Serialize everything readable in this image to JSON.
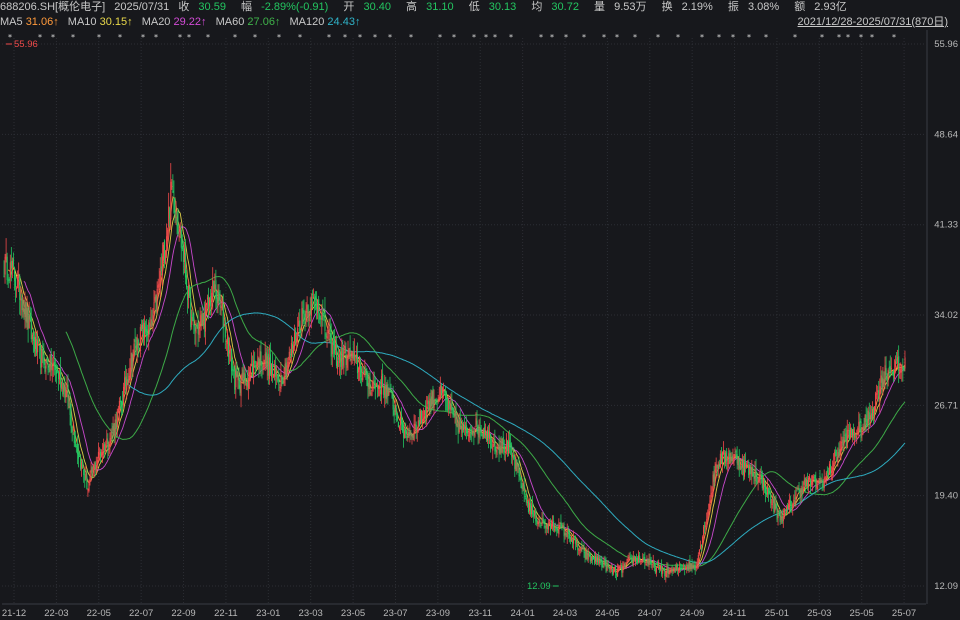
{
  "header": {
    "symbol": "688206.SH[概伦电子]",
    "date": "2025/07/31",
    "close_label": "收",
    "close": "30.59",
    "change_label": "幅",
    "change": "-2.89%(-0.91)",
    "open_label": "开",
    "open": "30.40",
    "high_label": "高",
    "high": "31.10",
    "low_label": "低",
    "low": "30.13",
    "avg_label": "均",
    "avg": "30.72",
    "volume_label": "量",
    "volume": "9.53万",
    "turnover_label": "换",
    "turnover": "2.19%",
    "amplitude_label": "振",
    "amplitude": "3.08%",
    "amount_label": "额",
    "amount": "2.93亿"
  },
  "range": "2021/12/28-2025/07/31(870日)",
  "ma": [
    {
      "name": "MA5",
      "value": "31.06↑",
      "color": "#ff9a3c"
    },
    {
      "name": "MA10",
      "value": "30.15↑",
      "color": "#e8d84a"
    },
    {
      "name": "MA20",
      "value": "29.22↑",
      "color": "#d24bd6"
    },
    {
      "name": "MA60",
      "value": "27.06↑",
      "color": "#3fb24a"
    },
    {
      "name": "MA120",
      "value": "24.43↑",
      "color": "#2fb3c8"
    }
  ],
  "colors": {
    "up": "#f04a4a",
    "down": "#23c560",
    "background": "#17181c",
    "grid": "#2c2e34"
  },
  "chart_data": {
    "type": "candlestick",
    "y_ticks": [
      "55.96",
      "48.64",
      "41.33",
      "34.02",
      "26.71",
      "19.40",
      "12.09"
    ],
    "ylim": [
      12.09,
      55.96
    ],
    "x_ticks": [
      "21-12",
      "22-03",
      "22-05",
      "22-07",
      "22-09",
      "22-11",
      "23-01",
      "23-03",
      "23-05",
      "23-07",
      "23-09",
      "23-11",
      "24-01",
      "24-03",
      "24-05",
      "24-07",
      "24-09",
      "24-11",
      "25-01",
      "25-03",
      "25-05",
      "25-07"
    ],
    "max_label": "55.96",
    "min_label": "12.09",
    "close_series": {
      "dates": [
        "21-12",
        "22-01",
        "22-02",
        "22-03",
        "22-04",
        "22-05",
        "22-06",
        "22-07",
        "22-08",
        "22-09",
        "22-10",
        "22-11",
        "22-12",
        "23-01",
        "23-02",
        "23-03",
        "23-04",
        "23-05",
        "23-06",
        "23-07",
        "23-08",
        "23-09",
        "23-10",
        "23-11",
        "23-12",
        "24-01",
        "24-02",
        "24-03",
        "24-04",
        "24-05",
        "24-06",
        "24-07",
        "24-08",
        "24-09",
        "24-10",
        "24-11",
        "24-12",
        "25-01",
        "25-02",
        "25-03",
        "25-04",
        "25-05",
        "25-06",
        "25-07"
      ],
      "values": [
        38.0,
        34.5,
        30.0,
        27.5,
        20.0,
        24.0,
        30.0,
        33.0,
        44.0,
        33.0,
        36.0,
        29.0,
        30.0,
        29.0,
        32.5,
        35.5,
        30.0,
        30.0,
        28.0,
        25.0,
        25.5,
        28.0,
        24.0,
        25.0,
        23.0,
        19.0,
        16.5,
        16.5,
        14.0,
        13.5,
        14.0,
        14.0,
        13.0,
        14.0,
        21.5,
        23.0,
        20.5,
        18.0,
        19.5,
        21.0,
        23.0,
        25.5,
        28.5,
        30.59
      ]
    },
    "ma_series": {
      "MA60": [
        null,
        null,
        null,
        31.5,
        28.0,
        25.5,
        26.0,
        27.5,
        31.0,
        33.5,
        35.5,
        34.0,
        33.0,
        31.5,
        31.0,
        31.5,
        31.5,
        31.0,
        30.5,
        29.0,
        27.5,
        27.0,
        26.0,
        25.5,
        25.0,
        23.0,
        20.5,
        18.5,
        17.0,
        15.5,
        15.0,
        14.5,
        14.0,
        13.7,
        15.5,
        18.0,
        20.0,
        20.5,
        19.5,
        20.0,
        21.0,
        22.5,
        24.5,
        27.06
      ],
      "MA120": [
        null,
        null,
        null,
        null,
        null,
        null,
        24.5,
        25.5,
        28.0,
        30.0,
        32.5,
        33.5,
        33.0,
        32.5,
        32.3,
        32.0,
        31.5,
        31.0,
        30.5,
        30.0,
        29.5,
        28.5,
        27.7,
        27.0,
        26.5,
        25.5,
        24.0,
        22.5,
        21.0,
        19.5,
        18.0,
        16.5,
        15.5,
        14.8,
        15.0,
        15.8,
        16.8,
        17.8,
        18.5,
        19.5,
        20.5,
        21.5,
        22.8,
        24.43
      ]
    },
    "event_markers": "*"
  }
}
